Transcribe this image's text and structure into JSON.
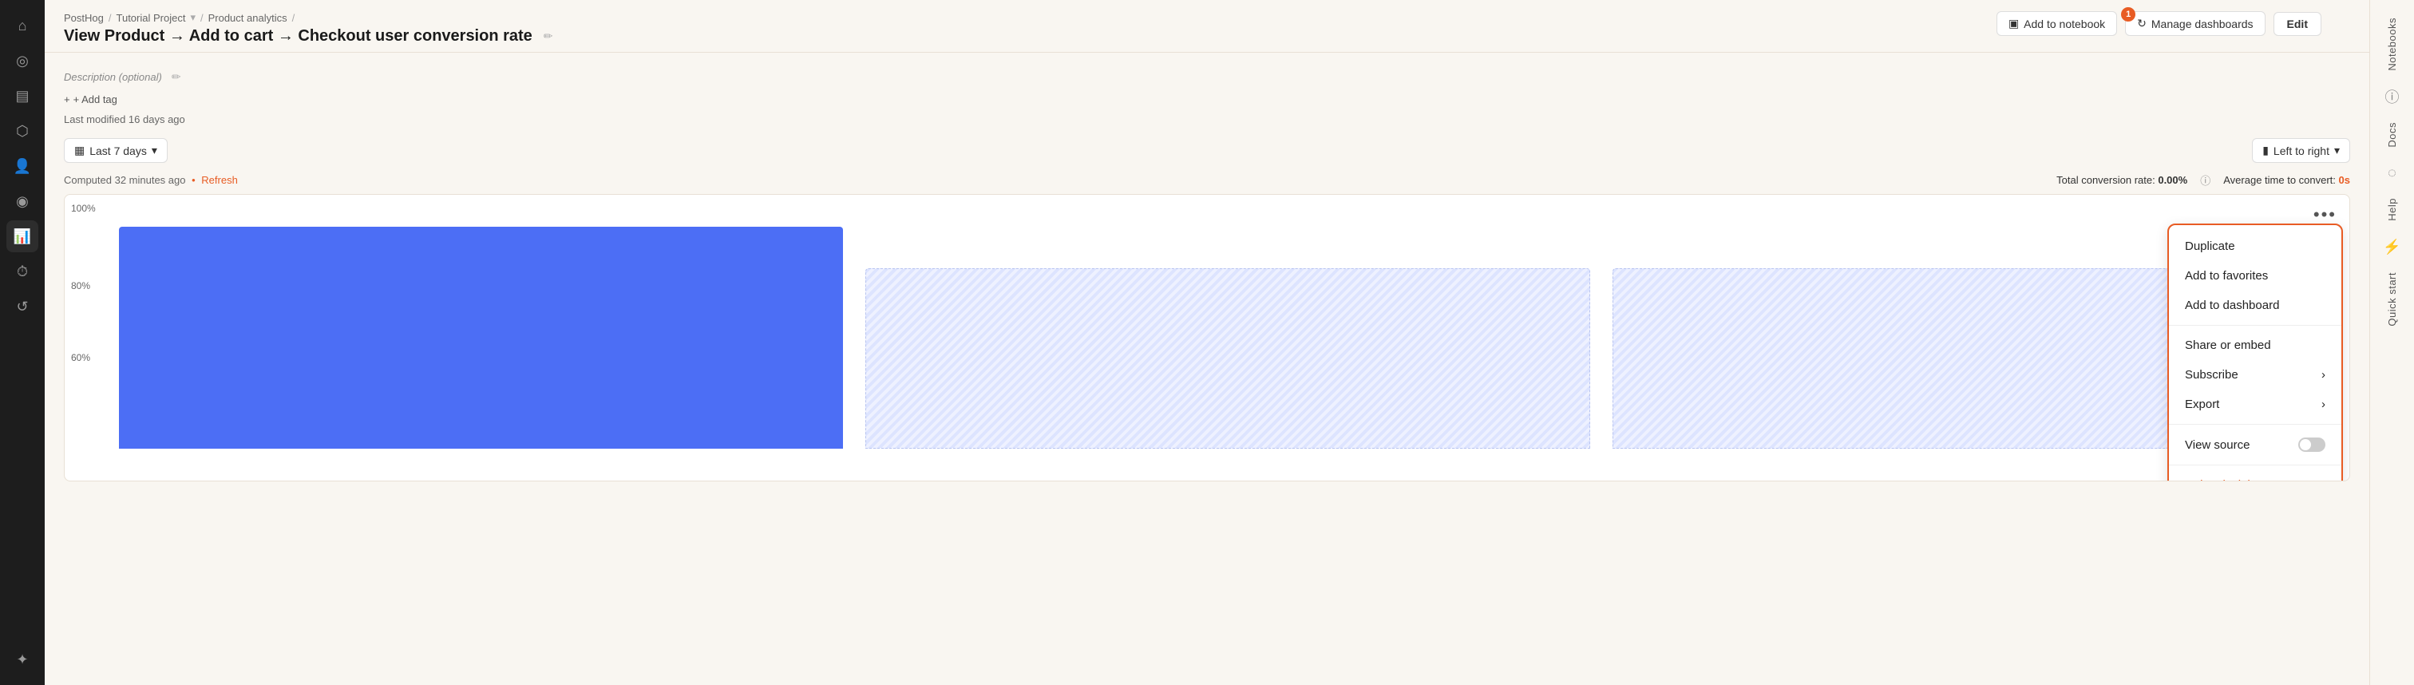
{
  "app": {
    "title": "PostHog"
  },
  "breadcrumb": {
    "items": [
      "PostHog",
      "Tutorial Project",
      "Product analytics"
    ]
  },
  "page": {
    "title": "View Product → Add to cart → Checkout user conversion rate",
    "description_placeholder": "Description (optional)",
    "add_tag_label": "+ Add tag",
    "last_modified": "Last modified 16 days ago"
  },
  "toolbar": {
    "add_notebook_label": "Add to notebook",
    "manage_dashboards_label": "Manage dashboards",
    "manage_dashboards_badge": "1",
    "edit_label": "Edit"
  },
  "filters": {
    "date_range_label": "Last 7 days",
    "layout_label": "Left to right"
  },
  "computed": {
    "text": "Computed 32 minutes ago",
    "refresh_label": "Refresh",
    "conversion_rate_label": "Total conversion rate:",
    "conversion_rate_value": "0.00%",
    "avg_time_label": "Average time to convert:",
    "avg_time_value": "0s"
  },
  "dropdown_menu": {
    "items": [
      {
        "id": "duplicate",
        "label": "Duplicate",
        "has_arrow": false,
        "danger": false
      },
      {
        "id": "add-favorites",
        "label": "Add to favorites",
        "has_arrow": false,
        "danger": false
      },
      {
        "id": "add-dashboard",
        "label": "Add to dashboard",
        "has_arrow": false,
        "danger": false
      },
      {
        "id": "share-embed",
        "label": "Share or embed",
        "has_arrow": false,
        "danger": false
      },
      {
        "id": "subscribe",
        "label": "Subscribe",
        "has_arrow": true,
        "danger": false
      },
      {
        "id": "export",
        "label": "Export",
        "has_arrow": true,
        "danger": false
      },
      {
        "id": "view-source",
        "label": "View source",
        "has_toggle": true,
        "danger": false
      },
      {
        "id": "delete",
        "label": "Delete insight",
        "has_arrow": false,
        "danger": true
      }
    ]
  },
  "chart": {
    "y_labels": [
      "100%",
      "80%",
      "60%"
    ],
    "bars": [
      {
        "type": "solid",
        "height_pct": 95
      },
      {
        "type": "hatched",
        "height_pct": 75
      },
      {
        "type": "hatched",
        "height_pct": 75
      }
    ]
  },
  "right_sidebar": {
    "items": [
      "Notebooks",
      "Docs",
      "Help",
      "Quick start"
    ]
  },
  "icons": {
    "home": "⌂",
    "activity": "◎",
    "notes": "▤",
    "database": "◫",
    "users": "👥",
    "wifi": "◉",
    "chart": "📊",
    "clock": "⏱",
    "update": "↺",
    "settings": "⚙",
    "edit_pencil": "✏",
    "calendar": "▦",
    "bar_chart": "▮",
    "chevron_down": "▾",
    "chevron_right": "›",
    "notebook": "▣",
    "refresh_circle": "↻",
    "info": "ⓘ",
    "three_dots": "•••",
    "plus": "+"
  }
}
